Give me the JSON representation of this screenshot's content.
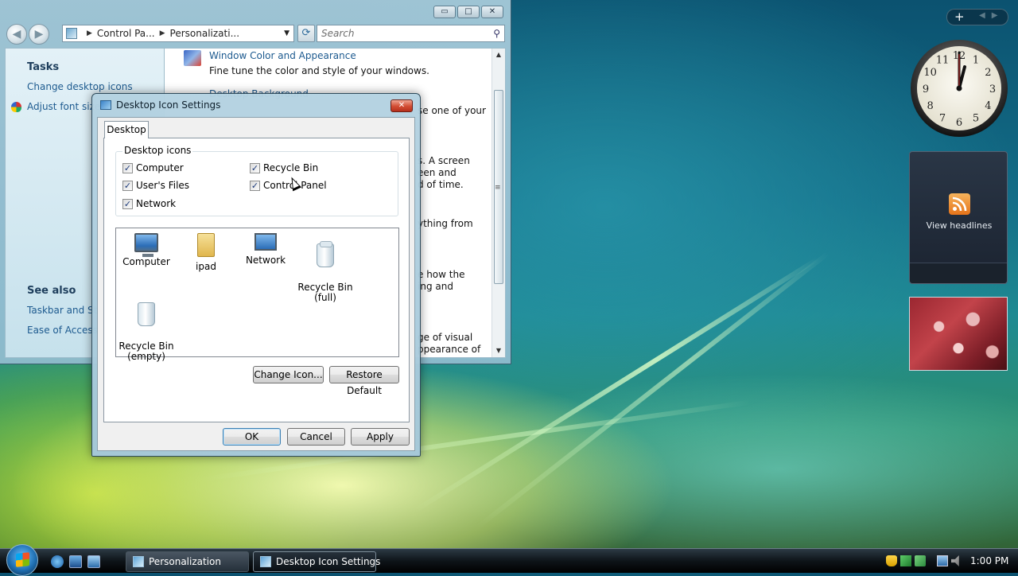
{
  "explorer": {
    "window_controls": {
      "minimize": "▭",
      "maximize": "□",
      "close": "✕"
    },
    "nav": {
      "back": "◀",
      "forward": "▶"
    },
    "breadcrumb": [
      "Control Pa...",
      "Personalizati..."
    ],
    "search_placeholder": "Search",
    "tasks_pane": {
      "tasks_header": "Tasks",
      "tasks": [
        "Change desktop icons",
        "Adjust font size"
      ],
      "see_also_header": "See also",
      "see_also": [
        "Taskbar and Sta",
        "Ease of Access"
      ]
    },
    "content": {
      "item1_title": "Window Color and Appearance",
      "item1_desc": "Fine tune the color and style of your windows.",
      "item2_title": "Desktop Background",
      "frag1": "se one of your",
      "frag2a": "s. A screen",
      "frag2b": "een and",
      "frag2c": "d of time.",
      "frag3": "ything from",
      "frag4a": "e how the",
      "frag4b": "ing and",
      "frag5a": "ge of visual",
      "frag5b": "ppearance of"
    }
  },
  "dialog": {
    "title": "Desktop Icon Settings",
    "close_label": "✕",
    "tab_label": "Desktop",
    "group_label": "Desktop icons",
    "checkboxes": [
      {
        "label": "Computer",
        "checked": true
      },
      {
        "label": "Recycle Bin",
        "checked": true
      },
      {
        "label": "User's Files",
        "checked": true
      },
      {
        "label": "Control Panel",
        "checked": true
      },
      {
        "label": "Network",
        "checked": true
      }
    ],
    "check_mark": "✓",
    "icons": [
      {
        "label": "Computer",
        "icon": "computer-icon"
      },
      {
        "label": "ipad",
        "icon": "folder-icon"
      },
      {
        "label": "Network",
        "icon": "network-icon"
      },
      {
        "label": "Recycle Bin\n(full)",
        "icon": "recycle-bin-full-icon"
      },
      {
        "label": "Recycle Bin\n(empty)",
        "icon": "recycle-bin-empty-icon"
      }
    ],
    "change_icon_button": "Change Icon...",
    "restore_default_button": "Restore Default",
    "ok_button": "OK",
    "cancel_button": "Cancel",
    "apply_button": "Apply"
  },
  "sidebar": {
    "add_gadget": "+",
    "feed_label": "View headlines",
    "clock_numbers": [
      "12",
      "1",
      "2",
      "3",
      "4",
      "5",
      "6",
      "7",
      "8",
      "9",
      "10",
      "11"
    ]
  },
  "taskbar": {
    "buttons": [
      {
        "label": "Personalization",
        "active": false
      },
      {
        "label": "Desktop Icon Settings",
        "active": true
      }
    ],
    "clock": "1:00 PM"
  },
  "colors": {
    "link": "#1d5a8f",
    "taskbar": "#0e1419",
    "dialog_frame": "#b4d2e1"
  }
}
